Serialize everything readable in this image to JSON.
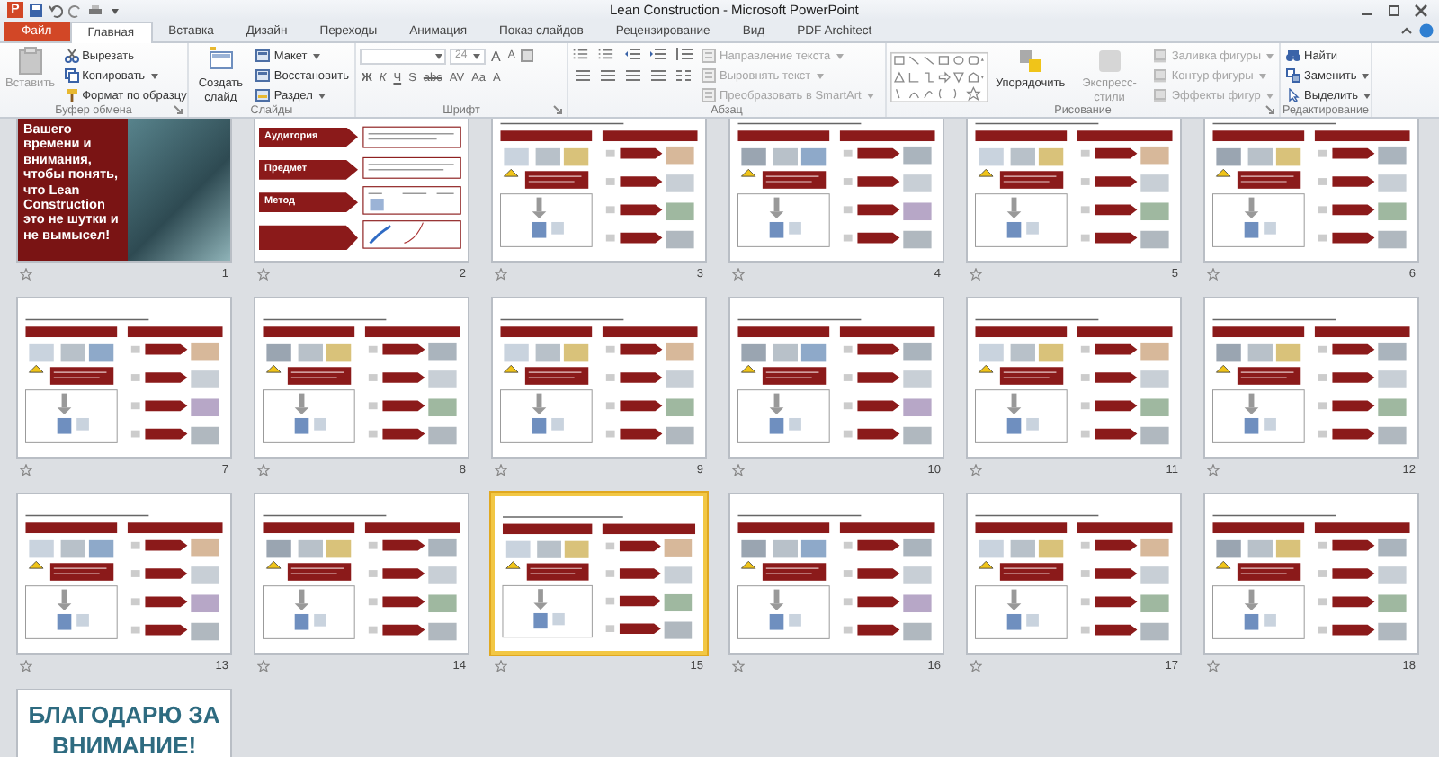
{
  "window": {
    "title": "Lean Construction - Microsoft PowerPoint",
    "app_badge": "P"
  },
  "tabs": [
    {
      "label": "Файл",
      "kind": "file",
      "selected": false
    },
    {
      "label": "Главная",
      "kind": "tab",
      "selected": true
    },
    {
      "label": "Вставка",
      "kind": "tab",
      "selected": false
    },
    {
      "label": "Дизайн",
      "kind": "tab",
      "selected": false
    },
    {
      "label": "Переходы",
      "kind": "tab",
      "selected": false
    },
    {
      "label": "Анимация",
      "kind": "tab",
      "selected": false
    },
    {
      "label": "Показ слайдов",
      "kind": "tab",
      "selected": false
    },
    {
      "label": "Рецензирование",
      "kind": "tab",
      "selected": false
    },
    {
      "label": "Вид",
      "kind": "tab",
      "selected": false
    },
    {
      "label": "PDF Architect",
      "kind": "tab",
      "selected": false
    }
  ],
  "ribbon": {
    "clipboard": {
      "label": "Буфер обмена",
      "paste": {
        "label": "Вставить",
        "disabled": true
      },
      "buttons": [
        {
          "label": "Вырезать",
          "dropdown": false
        },
        {
          "label": "Копировать",
          "dropdown": true
        },
        {
          "label": "Формат по образцу",
          "dropdown": false
        }
      ]
    },
    "slides": {
      "label": "Слайды",
      "new_slide": {
        "label": "Создать слайд"
      },
      "buttons": [
        {
          "label": "Макет",
          "dropdown": true
        },
        {
          "label": "Восстановить",
          "dropdown": false
        },
        {
          "label": "Раздел",
          "dropdown": true
        }
      ]
    },
    "font": {
      "label": "Шрифт",
      "size": "24",
      "grow": "A",
      "shrink": "A",
      "format_buttons": [
        "Ж",
        "К",
        "Ч",
        "S",
        "abc",
        "AV",
        "Aa",
        "A"
      ]
    },
    "paragraph": {
      "label": "Абзац",
      "buttons": [
        {
          "label": "Направление текста",
          "disabled": true
        },
        {
          "label": "Выровнять текст",
          "disabled": true
        },
        {
          "label": "Преобразовать в SmartArt",
          "disabled": true
        }
      ]
    },
    "drawing": {
      "label": "Рисование",
      "arrange": {
        "label": "Упорядочить",
        "disabled": false
      },
      "quick_styles": {
        "label": "Экспресс-стили",
        "disabled": true
      },
      "buttons": [
        {
          "label": "Заливка фигуры",
          "disabled": true
        },
        {
          "label": "Контур фигуры",
          "disabled": true
        },
        {
          "label": "Эффекты фигур",
          "disabled": true
        }
      ]
    },
    "editing": {
      "label": "Редактирование",
      "buttons": [
        {
          "label": "Найти",
          "dropdown": false
        },
        {
          "label": "Заменить",
          "dropdown": true
        },
        {
          "label": "Выделить",
          "dropdown": true
        }
      ]
    }
  },
  "slides": [
    {
      "number": "1",
      "kind": "photo-text",
      "selected": false,
      "text": "Вашего времени и внимания, чтобы понять, что Lean Construction это не шутки и не вымысел!"
    },
    {
      "number": "2",
      "kind": "labels",
      "selected": false,
      "labels": [
        "Аудитория",
        "Предмет",
        "Метод"
      ]
    },
    {
      "number": "3",
      "kind": "content",
      "selected": false
    },
    {
      "number": "4",
      "kind": "content",
      "selected": false
    },
    {
      "number": "5",
      "kind": "content",
      "selected": false
    },
    {
      "number": "6",
      "kind": "content",
      "selected": false
    },
    {
      "number": "7",
      "kind": "content",
      "selected": false
    },
    {
      "number": "8",
      "kind": "content",
      "selected": false
    },
    {
      "number": "9",
      "kind": "content",
      "selected": false
    },
    {
      "number": "10",
      "kind": "content",
      "selected": false
    },
    {
      "number": "11",
      "kind": "content",
      "selected": false
    },
    {
      "number": "12",
      "kind": "content",
      "selected": false
    },
    {
      "number": "13",
      "kind": "content",
      "selected": false
    },
    {
      "number": "14",
      "kind": "content",
      "selected": false
    },
    {
      "number": "15",
      "kind": "content",
      "selected": true
    },
    {
      "number": "16",
      "kind": "content",
      "selected": false
    },
    {
      "number": "17",
      "kind": "content",
      "selected": false
    },
    {
      "number": "18",
      "kind": "content",
      "selected": false
    },
    {
      "kind": "thanks",
      "selected": false,
      "text": "БЛАГОДАРЮ ЗА ВНИМАНИЕ!"
    }
  ]
}
